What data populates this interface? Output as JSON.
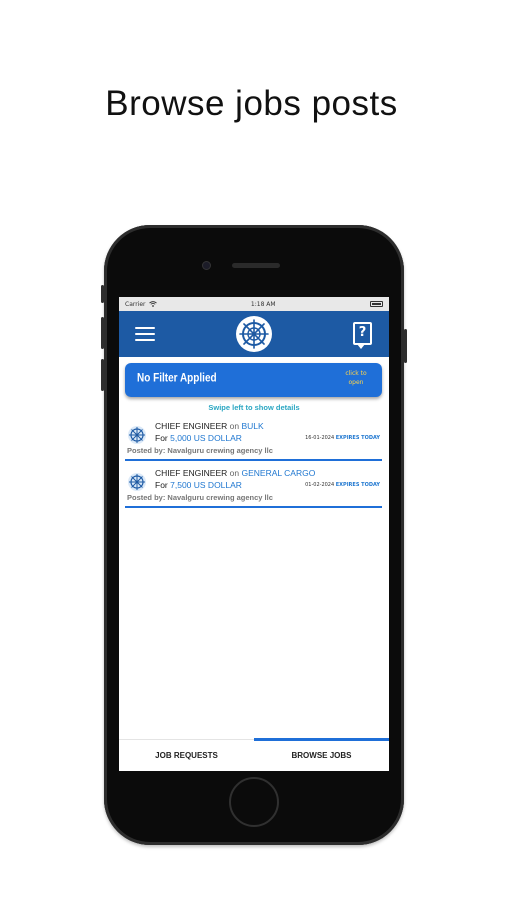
{
  "headline": "Browse jobs posts",
  "status_bar": {
    "carrier": "Carrier",
    "time": "1:18 AM"
  },
  "navbar": {
    "menu_icon": "hamburger-icon",
    "logo_icon": "ship-wheel-logo",
    "help_icon": "help-icon",
    "brand_color": "#1d5aa4"
  },
  "filter": {
    "label": "No Filter Applied",
    "open_line1": "click to",
    "open_line2": "open"
  },
  "swipe_hint": "Swipe left to show details",
  "jobs": [
    {
      "position": "CHIEF ENGINEER",
      "on_word": "on",
      "vessel": "BULK",
      "for_word": "For",
      "salary": "5,000 US DOLLAR",
      "date": "16-01-2024",
      "expires": "EXPIRES TODAY",
      "posted_by": "Posted by: Navalguru crewing agency llc"
    },
    {
      "position": "CHIEF ENGINEER",
      "on_word": "on",
      "vessel": "GENERAL CARGO",
      "for_word": "For",
      "salary": "7,500 US DOLLAR",
      "date": "01-02-2024",
      "expires": "EXPIRES TODAY",
      "posted_by": "Posted by: Navalguru crewing agency llc"
    }
  ],
  "tabs": [
    {
      "label": "JOB REQUESTS",
      "active": false
    },
    {
      "label": "BROWSE JOBS",
      "active": true
    }
  ],
  "accent_color": "#1f6fd8"
}
